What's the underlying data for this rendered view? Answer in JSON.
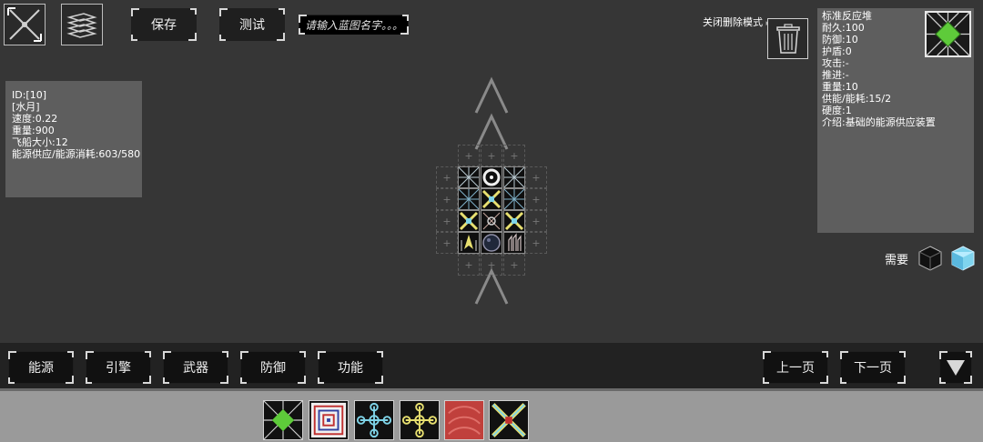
{
  "toolbar": {
    "save_label": "保存",
    "test_label": "测试",
    "name_placeholder": "请输入蓝图名字。。。",
    "delete_mode_label": "关闭删除模式"
  },
  "ship_info": {
    "lines": [
      "ID:[10]",
      "[水月]",
      "速度:0.22",
      "重量:900",
      "飞船大小:12",
      "能源供应/能源消耗:603/580"
    ]
  },
  "part_info": {
    "lines": [
      "标准反应堆",
      "耐久:100",
      "防御:10",
      "护盾:0",
      "攻击:-",
      "推进:-",
      "重量:10",
      "供能/能耗:15/2",
      "硬度:1",
      "介绍:基础的能源供应装置"
    ]
  },
  "requirement": {
    "label": "需要",
    "icons": [
      "black-cube-icon",
      "blue-cube-icon"
    ]
  },
  "categories": [
    "能源",
    "引擎",
    "武器",
    "防御",
    "功能"
  ],
  "paging": {
    "prev_label": "上一页",
    "next_label": "下一页"
  },
  "colors": {
    "background": "#363636",
    "panel": "#5e5e5e",
    "bar": "#222222",
    "tray": "#9a9a9a",
    "reactor_green": "#5ecb3a",
    "reactor_yellow": "#e8e070",
    "part_red": "#c0403c",
    "link_cyan": "#7fd4e8"
  },
  "palette": [
    "reactor-icon",
    "maze-core-icon",
    "cyan-node-icon",
    "yellow-node-icon",
    "red-armor-icon",
    "cross-reactor-icon"
  ]
}
